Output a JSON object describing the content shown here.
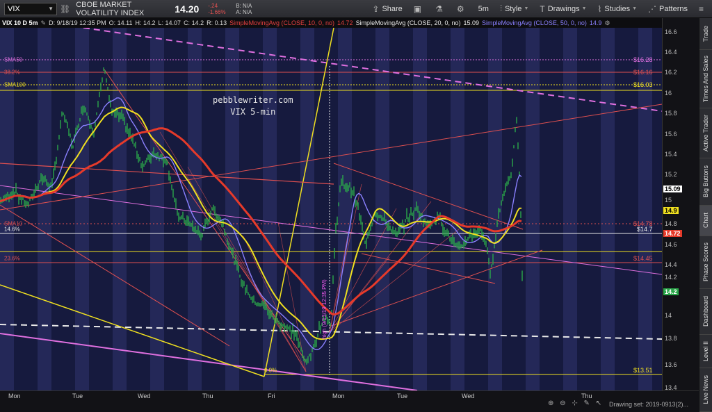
{
  "header": {
    "symbol": "VIX",
    "description": "CBOE MARKET VOLATILITY INDEX",
    "last": "14.20",
    "change": "-.24",
    "change_pct": "-1.66%",
    "bid": "B: N/A",
    "ask": "A: N/A",
    "buttons": {
      "share": "Share",
      "timeframe": "5m",
      "style": "Style",
      "drawings": "Drawings",
      "studies": "Studies",
      "patterns": "Patterns"
    }
  },
  "study_bar": {
    "symbol": "VIX 10 D 5m",
    "date": "D: 9/18/19 12:35 PM",
    "open": "O: 14.11",
    "high": "H: 14.2",
    "low": "L: 14.07",
    "close": "C: 14.2",
    "range": "R: 0.13",
    "sma10_label": "SimpleMovingAvg (CLOSE, 10, 0, no)",
    "sma10_value": "14.72",
    "sma20_label": "SimpleMovingAvg (CLOSE, 20, 0, no)",
    "sma20_value": "15.09",
    "sma50_label": "SimpleMovingAvg (CLOSE, 50, 0, no)",
    "sma50_value": "14.9"
  },
  "watermark": {
    "line1": "pebblewriter.com",
    "line2": "VIX 5-min"
  },
  "chart_labels": {
    "sma50": "SMA50",
    "fib382": "38.2%",
    "sma100": "SMA100",
    "sma10": "SMA10",
    "level146": "14.6%",
    "fib236": "23.6%",
    "fib0": "0.0%",
    "high_note": "high (9/13/19 12:35 PM)"
  },
  "right_labels": {
    "sma50": "$16.28",
    "fib382": "$16.16",
    "sma100": "$16.03",
    "sma10": "$14.78",
    "level": "$14.7",
    "fib236": "$14.45",
    "fib0": "$13.51"
  },
  "price_axis": {
    "ticks": [
      "16.6",
      "16.4",
      "16.2",
      "16",
      "15.8",
      "15.6",
      "15.4",
      "15.2",
      "15",
      "14.8",
      "14.6",
      "14.4",
      "14.2",
      "14",
      "13.8",
      "13.6",
      "13.4"
    ],
    "tags": {
      "sma20": "15.09",
      "sma50": "14.9",
      "sma10": "14.72",
      "last": "14.2"
    }
  },
  "time_axis": {
    "labels": [
      "Mon",
      "Tue",
      "Wed",
      "Thu",
      "Fri",
      "Mon",
      "Tue",
      "Wed",
      "Thu"
    ],
    "drawing_set": "Drawing set: 2019-0913(2)..."
  },
  "sidebar": {
    "tabs": [
      "Trade",
      "Times And Sales",
      "Active Trader",
      "Big Buttons",
      "Chart",
      "Phase Scores",
      "Dashboard",
      "Level II",
      "Live News"
    ]
  },
  "colors": {
    "sma10": "#e63a2a",
    "sma20": "#f0e020",
    "sma50": "#8a80ff",
    "price": "#2aa84a",
    "fib": "#e05050",
    "pink": "#e070e0"
  }
}
